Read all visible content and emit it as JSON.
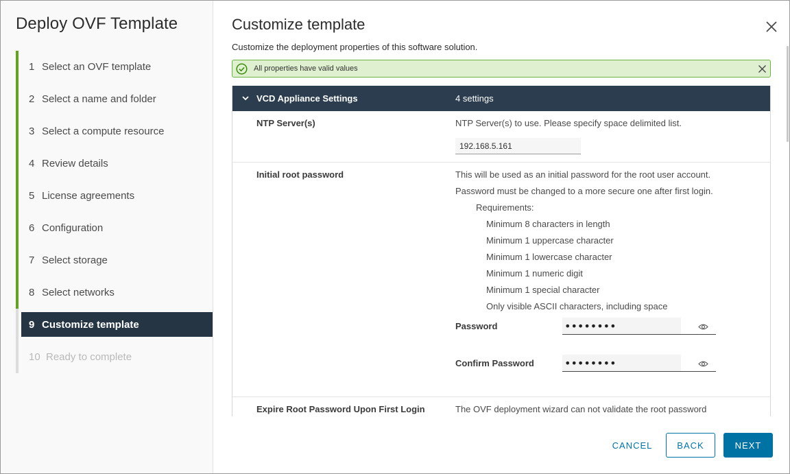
{
  "wizard": {
    "title": "Deploy OVF Template",
    "steps": [
      {
        "num": "1",
        "label": "Select an OVF template"
      },
      {
        "num": "2",
        "label": "Select a name and folder"
      },
      {
        "num": "3",
        "label": "Select a compute resource"
      },
      {
        "num": "4",
        "label": "Review details"
      },
      {
        "num": "5",
        "label": "License agreements"
      },
      {
        "num": "6",
        "label": "Configuration"
      },
      {
        "num": "7",
        "label": "Select storage"
      },
      {
        "num": "8",
        "label": "Select networks"
      },
      {
        "num": "9",
        "label": "Customize template"
      },
      {
        "num": "10",
        "label": "Ready to complete"
      }
    ],
    "active_step": "9"
  },
  "page": {
    "title": "Customize template",
    "subtitle": "Customize the deployment properties of this software solution."
  },
  "alert": {
    "message": "All properties have valid values"
  },
  "group": {
    "name": "VCD Appliance Settings",
    "count": "4 settings"
  },
  "ntp": {
    "label": "NTP Server(s)",
    "description": "NTP Server(s) to use. Please specify space delimited list.",
    "value": "192.168.5.161"
  },
  "root_password": {
    "label": "Initial root password",
    "description_1": "This will be used as an initial password for the root user account.",
    "description_2": "Password must be changed to a more secure one after first login.",
    "requirements_title": "Requirements:",
    "requirements": [
      "Minimum 8 characters in length",
      "Minimum 1 uppercase character",
      "Minimum 1 lowercase character",
      "Minimum 1 numeric digit",
      "Minimum 1 special character",
      "Only visible ASCII characters, including space"
    ],
    "password_label": "Password",
    "password_value": "••••••••",
    "confirm_label": "Confirm Password",
    "confirm_value": "••••••••"
  },
  "expire": {
    "label": "Expire Root Password Upon First Login",
    "description": "The OVF deployment wizard can not validate the root password"
  },
  "footer": {
    "cancel": "CANCEL",
    "back": "BACK",
    "next": "NEXT"
  },
  "colors": {
    "progress_green": "#62a420",
    "active_step_bg": "#253544",
    "group_header_bg": "#2b3d4e",
    "primary_blue": "#0072a3",
    "success_bg": "#dff0d0"
  }
}
